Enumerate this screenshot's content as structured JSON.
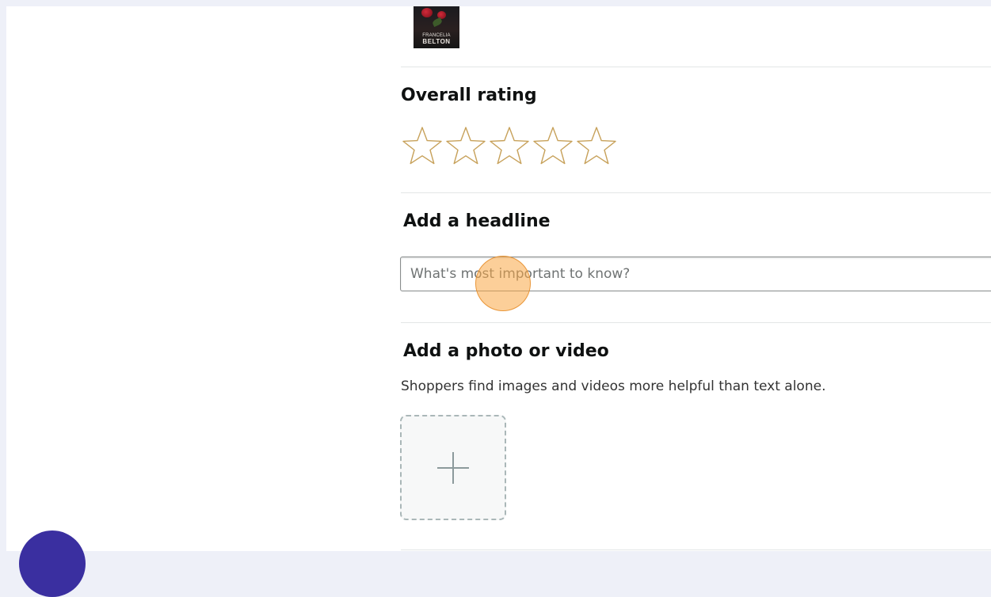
{
  "product": {
    "cover_author_first": "FRANCELIA",
    "cover_author_last": "BELTON"
  },
  "rating": {
    "title": "Overall rating",
    "max_stars": 5,
    "selected": 0,
    "star_color": "#c7a15a"
  },
  "headline": {
    "title": "Add a headline",
    "placeholder": "What's most important to know?",
    "value": ""
  },
  "media": {
    "title": "Add a photo or video",
    "helper": "Shoppers find images and videos more helpful than text alone.",
    "upload_icon": "plus-icon"
  },
  "colors": {
    "page_bg": "#eef0f8",
    "text": "#0f1111",
    "divider": "#e3e6e6",
    "click_indicator": "#f9a846",
    "assistant_bubble": "#3a2fa0"
  }
}
